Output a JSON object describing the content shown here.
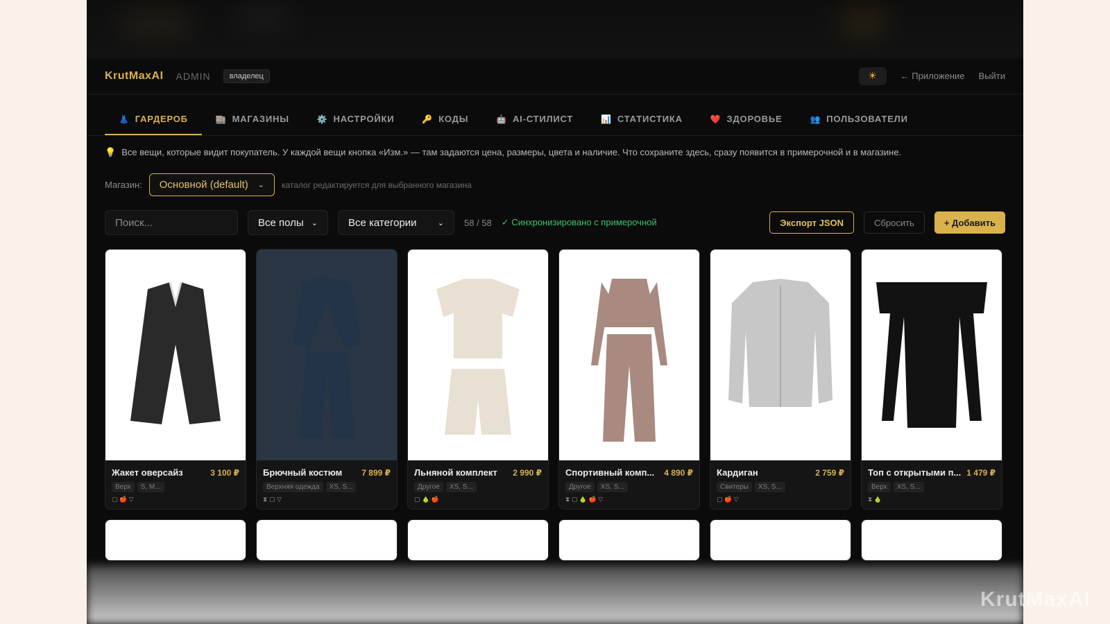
{
  "header": {
    "logo": "KrutMaxAI",
    "admin": "ADMIN",
    "role_badge": "владелец",
    "theme_icon": "sun-icon",
    "app_link": "← Приложение",
    "logout": "Выйти"
  },
  "tabs": [
    {
      "icon": "hanger-icon",
      "glyph": "👗",
      "label": "ГАРДЕРОБ",
      "active": true
    },
    {
      "icon": "store-icon",
      "glyph": "🏬",
      "label": "МАГАЗИНЫ"
    },
    {
      "icon": "gear-icon",
      "glyph": "⚙️",
      "label": "НАСТРОЙКИ"
    },
    {
      "icon": "key-icon",
      "glyph": "🔑",
      "label": "КОДЫ"
    },
    {
      "icon": "robot-icon",
      "glyph": "🤖",
      "label": "AI-СТИЛИСТ"
    },
    {
      "icon": "chart-icon",
      "glyph": "📊",
      "label": "СТАТИСТИКА"
    },
    {
      "icon": "heart-icon",
      "glyph": "❤️",
      "label": "ЗДОРОВЬЕ"
    },
    {
      "icon": "users-icon",
      "glyph": "👥",
      "label": "ПОЛЬЗОВАТЕЛИ"
    }
  ],
  "hint": "Все вещи, которые видит покупатель. У каждой вещи кнопка «Изм.» — там задаются цена, размеры, цвета и наличие. Что сохраните здесь, сразу появится в примерочной и в магазине.",
  "store": {
    "label": "Магазин:",
    "value": "Основной (default)",
    "note": "каталог редактируется для выбранного магазина"
  },
  "toolbar": {
    "search_placeholder": "Поиск...",
    "gender": "Все полы",
    "category": "Все категории",
    "count": "58 / 58",
    "sync": "✓ Синхронизировано с примерочной",
    "export": "Экспорт JSON",
    "reset": "Сбросить",
    "add": "+ Добавить"
  },
  "items": [
    {
      "name": "Жакет оверсайз",
      "price": "3 100 ₽",
      "category": "Верх",
      "sizes": "S, M...",
      "marks": "▢ 🍎 ▽",
      "color": "#2a2a2a",
      "shape": "blazer"
    },
    {
      "name": "Брючный костюм",
      "price": "7 899 ₽",
      "category": "Верхняя одежда",
      "sizes": "XS, S...",
      "marks": "⧗ ▢ ▽",
      "color": "#243448",
      "shape": "suit",
      "dim": true
    },
    {
      "name": "Льняной комплект",
      "price": "2 990 ₽",
      "category": "Другое",
      "sizes": "XS, S...",
      "marks": "▢ 🍐 🍎",
      "color": "#e8e0d2",
      "shape": "set"
    },
    {
      "name": "Спортивный комп...",
      "price": "4 890 ₽",
      "category": "Другое",
      "sizes": "XS, S...",
      "marks": "⧗ ▢ 🍐 🍎 ▽",
      "color": "#a88a80",
      "shape": "tracksuit"
    },
    {
      "name": "Кардиган",
      "price": "2 759 ₽",
      "category": "Свитеры",
      "sizes": "XS, S...",
      "marks": "▢ 🍎 ▽",
      "color": "#c7c7c7",
      "shape": "cardigan"
    },
    {
      "name": "Топ с открытыми п...",
      "price": "1 479 ₽",
      "category": "Верх",
      "sizes": "XS, S...",
      "marks": "⧗ 🍐",
      "color": "#121212",
      "shape": "top"
    }
  ],
  "row2_count": 6,
  "watermark": "KrutMaxAI"
}
